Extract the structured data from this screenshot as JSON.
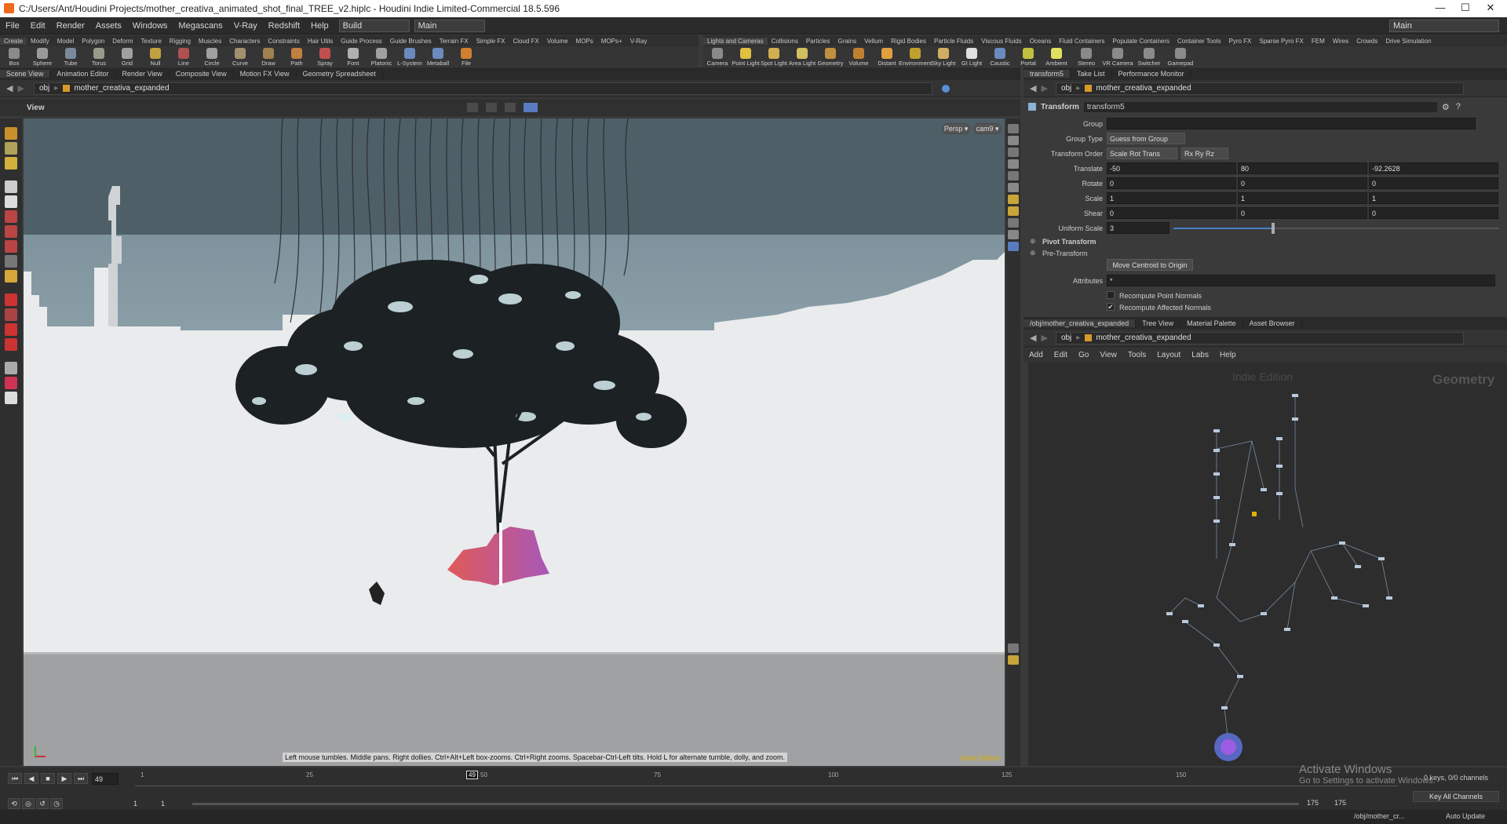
{
  "window": {
    "title": "C:/Users/Ant/Houdini Projects/mother_creativa_animated_shot_final_TREE_v2.hiplc - Houdini Indie Limited-Commercial 18.5.596",
    "controls": [
      "—",
      "☐",
      "✕"
    ]
  },
  "menu": {
    "items": [
      "File",
      "Edit",
      "Render",
      "Assets",
      "Windows",
      "Megascans",
      "V-Ray",
      "Redshift",
      "Help"
    ],
    "desktop": "Build",
    "runtime": "Main",
    "right_runtime": "Main"
  },
  "shelf_left": {
    "tabs": [
      "Create",
      "Modify",
      "Model",
      "Polygon",
      "Deform",
      "Texture",
      "Rigging",
      "Muscles",
      "Characters",
      "Constraints",
      "Hair Utils",
      "Guide Process",
      "Guide Brushes",
      "Terrain FX",
      "Simple FX",
      "Cloud FX",
      "Volume",
      "MOPs",
      "MOPs+",
      "V-Ray"
    ],
    "tools": [
      "Box",
      "Sphere",
      "Tube",
      "Torus",
      "Grid",
      "Null",
      "Line",
      "Circle",
      "Curve",
      "Draw Curve",
      "Path",
      "Spray Paint",
      "Font",
      "Platonic Solids",
      "L-System",
      "Metaball",
      "File"
    ]
  },
  "shelf_right": {
    "tabs": [
      "Lights and Cameras",
      "Collisions",
      "Particles",
      "Grains",
      "Vellum",
      "Rigid Bodies",
      "Particle Fluids",
      "Viscous Fluids",
      "Oceans",
      "Fluid Containers",
      "Populate Containers",
      "Container Tools",
      "Pyro FX",
      "Sparse Pyro FX",
      "FEM",
      "Wires",
      "Crowds",
      "Drive Simulation"
    ],
    "tools": [
      "Camera",
      "Point Light",
      "Spot Light",
      "Area Light",
      "Geometry Light",
      "Volume Light",
      "Distant Light",
      "Environment Light",
      "Sky Light",
      "GI Light",
      "Caustic Light",
      "Portal Light",
      "Ambient Light",
      "Stereo Camera",
      "VR Camera",
      "Switcher",
      "Gamepad Camera"
    ]
  },
  "left_panes": {
    "tabs": [
      "Scene View",
      "Animation Editor",
      "Render View",
      "Composite View",
      "Motion FX View",
      "Geometry Spreadsheet"
    ],
    "path_root": "obj",
    "path_node": "mother_creativa_expanded",
    "view_label": "View",
    "persp": "Persp ▾",
    "camera": "cam9 ▾",
    "hint": "Left mouse tumbles. Middle pans. Right dollies. Ctrl+Alt+Left box-zooms. Ctrl+Right zooms. Spacebar-Ctrl-Left tilts. Hold L for alternate tumble, dolly, and zoom.",
    "watermark": "Indie Edition"
  },
  "params": {
    "tabs": [
      "transform5",
      "Take List",
      "Performance Monitor"
    ],
    "path_root": "obj",
    "path_node": "mother_creativa_expanded",
    "node_type": "Transform",
    "node_name": "transform5",
    "group_label": "Group",
    "group_type_label": "Group Type",
    "group_type_value": "Guess from Group",
    "transform_order_label": "Transform Order",
    "transform_order_value": "Scale Rot Trans",
    "rot_order_value": "Rx Ry Rz",
    "translate_label": "Translate",
    "translate": [
      "-50",
      "80",
      "-92.2628"
    ],
    "rotate_label": "Rotate",
    "rotate": [
      "0",
      "0",
      "0"
    ],
    "scale_label": "Scale",
    "scale": [
      "1",
      "1",
      "1"
    ],
    "shear_label": "Shear",
    "shear": [
      "0",
      "0",
      "0"
    ],
    "uniform_scale_label": "Uniform Scale",
    "uniform_scale": "3",
    "uniform_scale_slider": 0.3,
    "pivot_label": "Pivot Transform",
    "pretransform_label": "Pre-Transform",
    "centroid_button": "Move Centroid to Origin",
    "attributes_label": "Attributes",
    "attributes_value": "*",
    "recompute_points": "Recompute Point Normals",
    "recompute_points_checked": false,
    "recompute_affected": "Recompute Affected Normals",
    "recompute_affected_checked": true
  },
  "network": {
    "tabs": [
      "/obj/mother_creativa_expanded",
      "Tree View",
      "Material Palette",
      "Asset Browser"
    ],
    "path_root": "obj",
    "path_node": "mother_creativa_expanded",
    "menu": [
      "Add",
      "Edit",
      "Go",
      "View",
      "Tools",
      "Layout",
      "Labs",
      "Help"
    ],
    "watermark": "Indie Edition",
    "context": "Geometry"
  },
  "timeline": {
    "current_frame": "49",
    "ticks": [
      "1",
      "25",
      "50",
      "75",
      "100",
      "125",
      "150"
    ],
    "marker": "49",
    "range_start": "1",
    "range_start2": "1",
    "range_end": "175",
    "range_end2": "175",
    "keys_info": "0 keys, 0/0 channels",
    "key_all": "Key All Channels",
    "status_path": "/obj/mother_cr...",
    "auto_update": "Auto Update",
    "activate_title": "Activate Windows",
    "activate_sub": "Go to Settings to activate Windows."
  },
  "colors": {
    "accent": "#f0b000",
    "selected_node": "#7a5cd6"
  }
}
